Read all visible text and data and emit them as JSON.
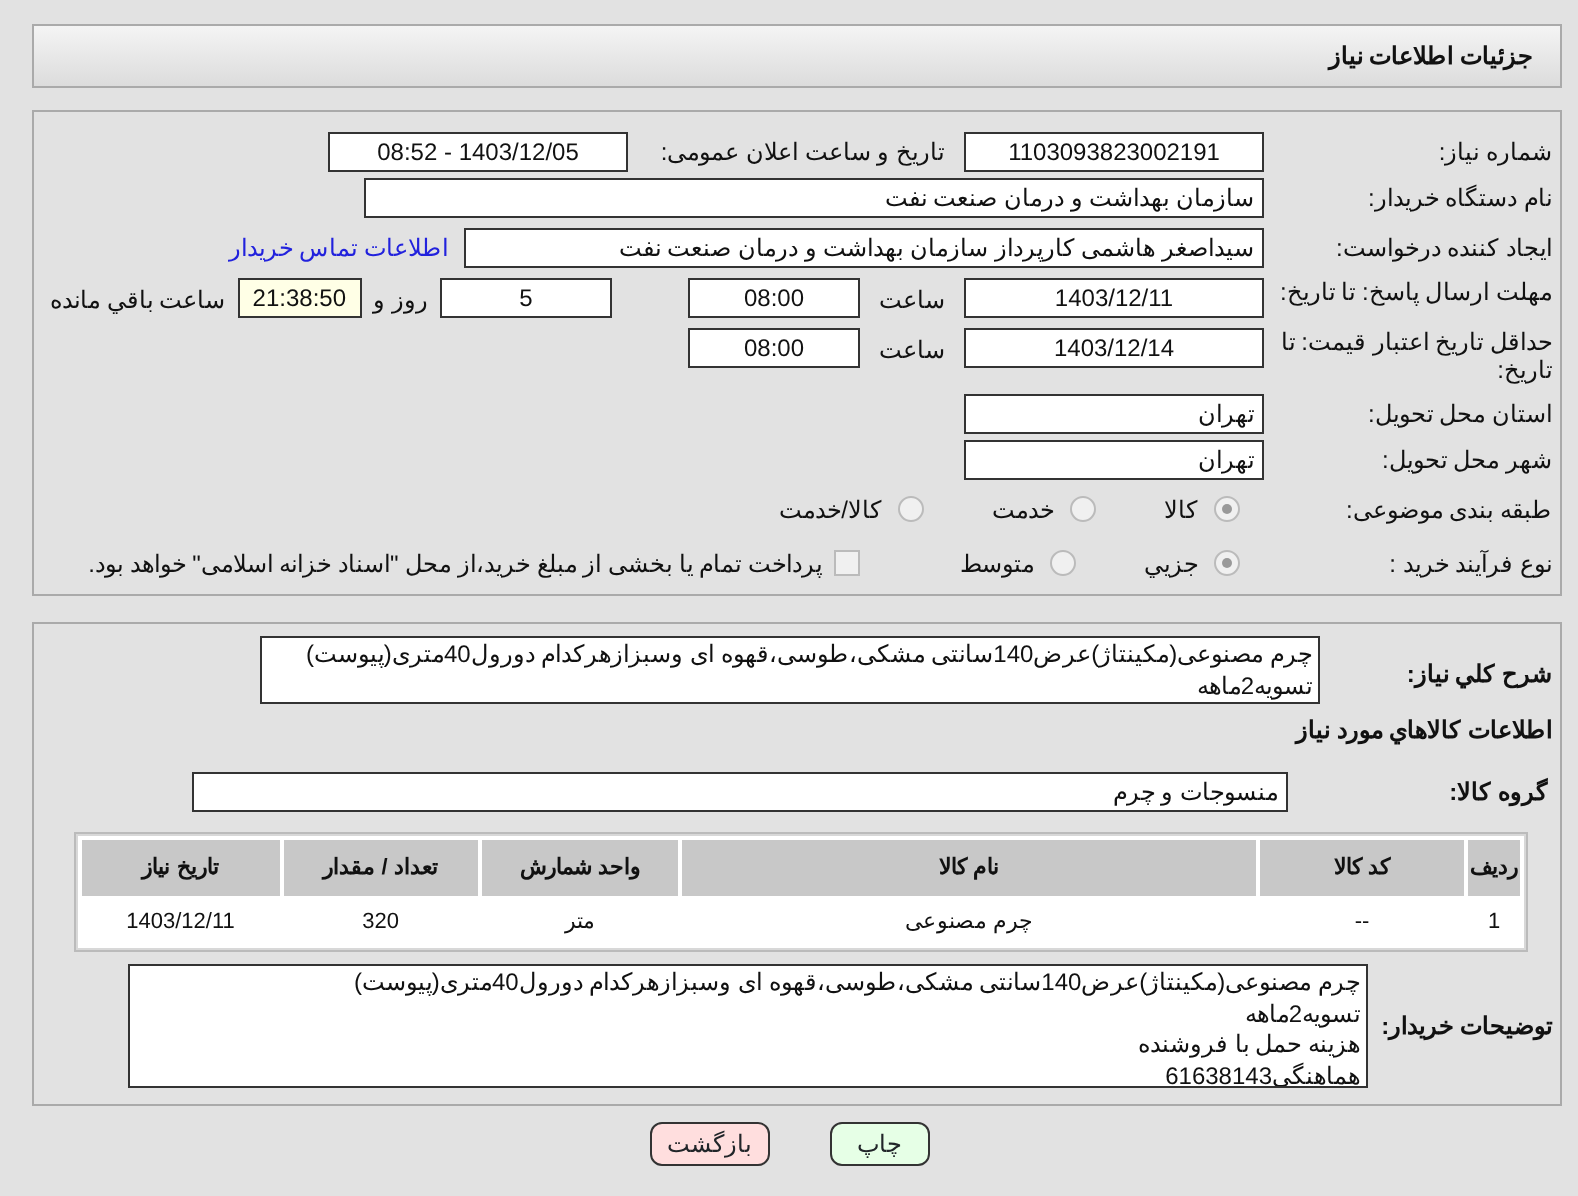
{
  "header": {
    "title": "جزئیات اطلاعات نیاز"
  },
  "details": {
    "need_number": {
      "label": "شماره نیاز:",
      "value": "1103093823002191"
    },
    "announce": {
      "label": "تاریخ و ساعت اعلان عمومی:",
      "value": "1403/12/05 - 08:52"
    },
    "buyer_org": {
      "label": "نام دستگاه خریدار:",
      "value": "سازمان بهداشت و درمان صنعت نفت"
    },
    "requester": {
      "label": "ایجاد کننده درخواست:",
      "value": "سیداصغر هاشمی کارپرداز سازمان بهداشت و درمان صنعت نفت",
      "link": "اطلاعات تماس خریدار"
    },
    "reply_deadline": {
      "label": "مهلت ارسال پاسخ: تا تاریخ:",
      "date": "1403/12/11",
      "time_label": "ساعت",
      "time": "08:00",
      "days": "5",
      "days_label": "روز و",
      "remaining": "21:38:50",
      "remaining_label": "ساعت باقي مانده"
    },
    "price_validity": {
      "label": "حداقل تاریخ اعتبار قیمت: تا تاریخ:",
      "date": "1403/12/14",
      "time_label": "ساعت",
      "time": "08:00"
    },
    "province": {
      "label": "استان محل تحویل:",
      "value": "تهران"
    },
    "city": {
      "label": "شهر محل تحویل:",
      "value": "تهران"
    },
    "category": {
      "label": "طبقه بندی موضوعی:",
      "options": [
        {
          "label": "کالا",
          "selected": true
        },
        {
          "label": "خدمت",
          "selected": false
        },
        {
          "label": "کالا/خدمت",
          "selected": false
        }
      ]
    },
    "process": {
      "label": "نوع فرآیند خرید :",
      "options": [
        {
          "label": "جزیي",
          "selected": true
        },
        {
          "label": "متوسط",
          "selected": false
        }
      ],
      "payment": {
        "label": "پرداخت تمام یا بخشی از مبلغ خرید،از محل \"اسناد خزانه اسلامی\" خواهد بود.",
        "checked": false
      }
    }
  },
  "need": {
    "label": "شرح کلي نیاز:",
    "text": "چرم مصنوعی(مکینتاژ)عرض140سانتی مشکی،طوسی،قهوه ای وسبزازهرکدام دورول40متری(پیوست)\nتسویه2ماهه",
    "goods_heading": "اطلاعات کالاهاي مورد نیاز",
    "group": {
      "label": "گروه کالا:",
      "value": "منسوجات و چرم"
    },
    "table": {
      "columns": [
        "ردیف",
        "کد کالا",
        "نام کالا",
        "واحد شمارش",
        "تعداد / مقدار",
        "تاریخ نیاز"
      ],
      "rows": [
        [
          "1",
          "--",
          "چرم مصنوعی",
          "متر",
          "320",
          "1403/12/11"
        ]
      ]
    },
    "notes": {
      "label": "توضیحات خریدار:",
      "text": "چرم مصنوعی(مکینتاژ)عرض140سانتی مشکی،طوسی،قهوه ای وسبزازهرکدام دورول40متری(پیوست)\nتسویه2ماهه\nهزینه حمل با فروشنده\nهماهنگی61638143"
    }
  },
  "buttons": [
    {
      "label": "چاپ",
      "kind": "print"
    },
    {
      "label": "بازگشت",
      "kind": "back"
    }
  ]
}
